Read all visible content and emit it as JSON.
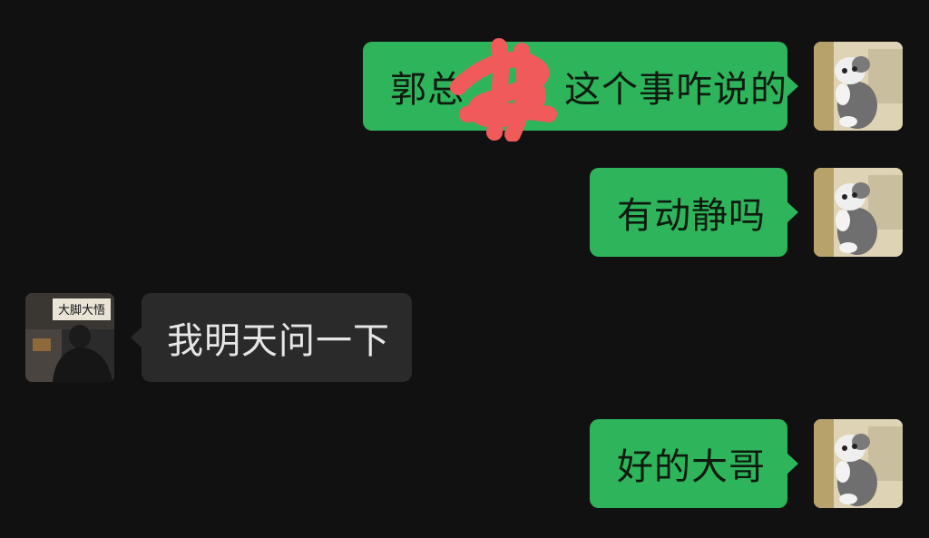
{
  "messages": [
    {
      "side": "out",
      "text_before": "郭总",
      "text_after": "这个事咋说的",
      "redaction": "red-scribble"
    },
    {
      "side": "out",
      "text": "有动静吗"
    },
    {
      "side": "in",
      "text": "我明天问一下"
    },
    {
      "side": "out",
      "text": "好的大哥"
    }
  ],
  "avatars": {
    "me": {
      "icon": "cat-avatar-icon"
    },
    "contact": {
      "icon": "person-avatar-icon",
      "sign_text": "大脚大悟"
    }
  },
  "colors": {
    "background": "#111111",
    "outgoing_bubble": "#2eb55b",
    "incoming_bubble": "#2a2a2a",
    "redaction": "#f05a5a"
  }
}
